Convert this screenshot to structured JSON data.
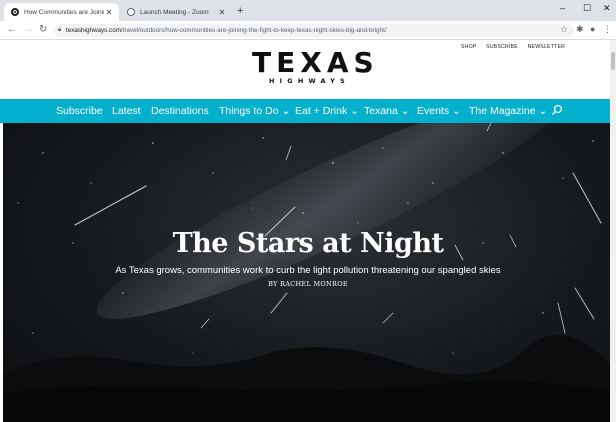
{
  "browser": {
    "tabs": [
      {
        "title": "How Communities are Joining th",
        "active": true
      },
      {
        "title": "Launch Meeting - Zoom",
        "active": false
      }
    ],
    "new_tab": "+",
    "url_host": "texashighways.com",
    "url_path": "/travel/outdoors/how-communities-are-joining-the-fight-to-keep-texas-night-skies-big-and-bright/",
    "window_controls": [
      "–",
      "☐",
      "✕"
    ]
  },
  "site": {
    "utility_links": [
      "SHOP",
      "SUBSCRIBE",
      "NEWSLETTER"
    ],
    "logo": {
      "main": "TEXAS",
      "sub": "HIGHWAYS"
    },
    "nav": [
      "Subscribe",
      "Latest",
      "Destinations",
      "Things to Do ⌄",
      "Eat + Drink ⌄",
      "Texana ⌄",
      "Events ⌄",
      "The Magazine ⌄"
    ],
    "nav_color": "#05b0cc"
  },
  "hero": {
    "title": "The Stars at Night",
    "subtitle": "As Texas grows, communities work to curb the light pollution threatening our spangled skies",
    "byline": "BY RACHEL MONROE"
  }
}
